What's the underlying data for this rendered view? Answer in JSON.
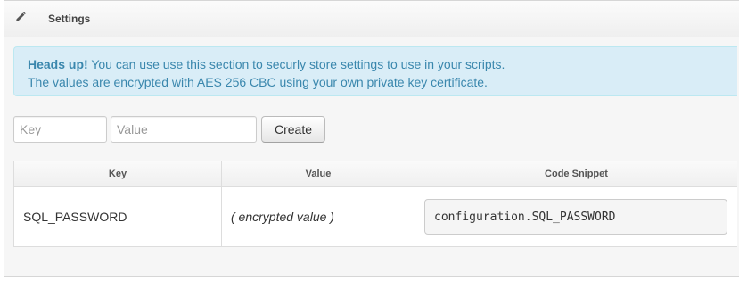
{
  "header": {
    "icon": "pencil-icon",
    "title": "Settings"
  },
  "alert": {
    "lead": "Heads up!",
    "line1": "You can use use this section to securly store settings to use in your scripts.",
    "line2": "The values are encrypted with AES 256 CBC using your own private key certificate."
  },
  "form": {
    "key_placeholder": "Key",
    "value_placeholder": "Value",
    "create_label": "Create"
  },
  "table": {
    "columns": [
      "Key",
      "Value",
      "Code Snippet"
    ],
    "rows": [
      {
        "key": "SQL_PASSWORD",
        "value": "( encrypted value )",
        "snippet": "configuration.SQL_PASSWORD"
      }
    ]
  }
}
